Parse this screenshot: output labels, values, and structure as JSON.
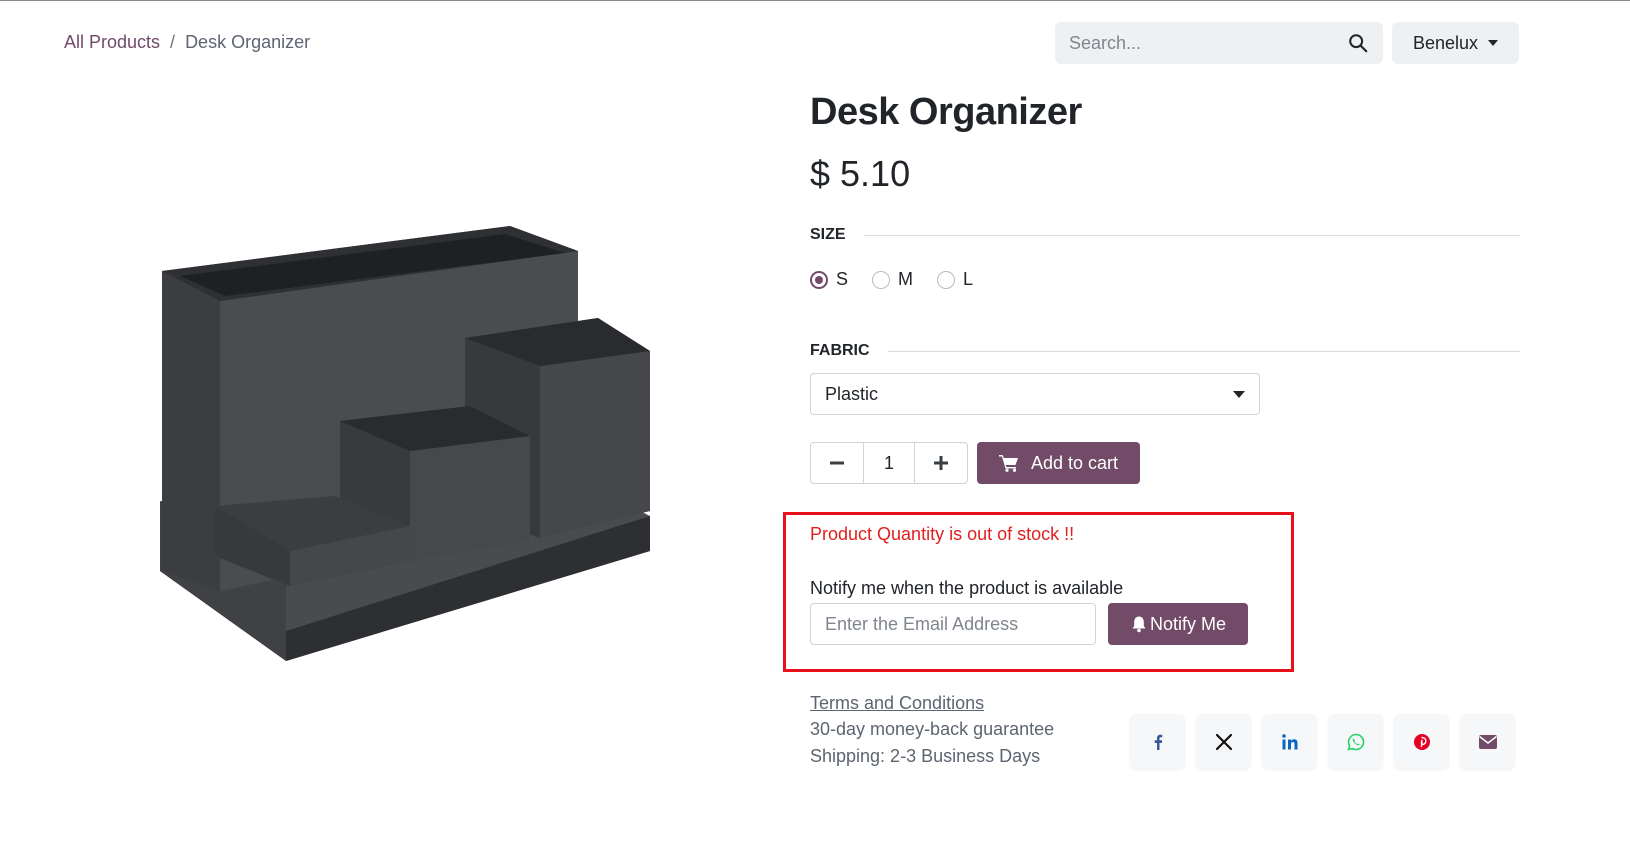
{
  "breadcrumb": {
    "root": "All Products",
    "separator": "/",
    "current": "Desk Organizer"
  },
  "header": {
    "search_placeholder": "Search...",
    "pricelist": "Benelux"
  },
  "product": {
    "name": "Desk Organizer",
    "price": "$ 5.10",
    "image_icon": "desk-organizer-image"
  },
  "attributes": {
    "size": {
      "label": "SIZE",
      "options": [
        "S",
        "M",
        "L"
      ],
      "selected": "S"
    },
    "fabric": {
      "label": "FABRIC",
      "selected": "Plastic"
    }
  },
  "cart": {
    "quantity": "1",
    "minus_icon": "minus-icon",
    "plus_icon": "plus-icon",
    "add_label": "Add to cart"
  },
  "stock": {
    "message": "Product Quantity is out of stock !!",
    "notify_label": "Notify me when the product is available",
    "email_placeholder": "Enter the Email Address",
    "notify_button": "Notify Me"
  },
  "info": {
    "terms": "Terms and Conditions",
    "guarantee": "30-day money-back guarantee",
    "shipping": "Shipping: 2-3 Business Days"
  },
  "share": [
    "facebook-icon",
    "x-icon",
    "linkedin-icon",
    "whatsapp-icon",
    "pinterest-icon",
    "email-icon"
  ],
  "colors": {
    "primary": "#714b67",
    "alert": "#e02020",
    "highlight_border": "#e8101a"
  }
}
